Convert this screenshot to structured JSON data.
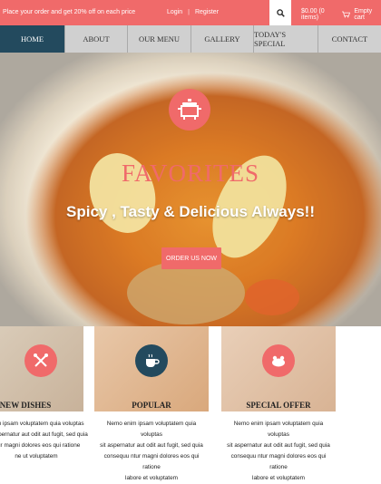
{
  "topbar": {
    "promo": "Place your order and get 20% off on each price",
    "login": "Login",
    "register": "Register",
    "cart_total": "$0.00 (0 items)",
    "cart_label": "Empty cart"
  },
  "nav": {
    "items": [
      {
        "label": "HOME"
      },
      {
        "label": "ABOUT"
      },
      {
        "label": "OUR MENU"
      },
      {
        "label": "GALLERY"
      },
      {
        "label": "TODAY'S SPECIAL"
      },
      {
        "label": "CONTACT"
      }
    ]
  },
  "hero": {
    "title": "FAVORITES",
    "tagline": "Spicy , Tasty & Delicious Always!!",
    "cta": "ORDER US NOW"
  },
  "features": [
    {
      "title": "NEW DISHES",
      "icon": "fork-knife-icon",
      "text": [
        "enim ipsam voluptatem quia voluptas",
        "sit aspernatur aut odit aut fugit, sed quia",
        "ntur magni dolores eos qui ratione",
        "ne ut voluptatem"
      ]
    },
    {
      "title": "POPULAR",
      "icon": "coffee-cup-icon",
      "text": [
        "Nemo enim ipsam voluptatem quia voluptas",
        "sit aspernatur aut odit aut fugit, sed quia",
        "consequu ntur magni dolores eos qui ratione",
        "labore et voluptatem"
      ]
    },
    {
      "title": "SPECIAL OFFER",
      "icon": "roast-chicken-icon",
      "text": [
        "Nemo enim ipsam voluptatem quia voluptas",
        "sit aspernatur aut odit aut fugit, sed quia",
        "consequu ntur magni dolores eos qui ratione",
        "labore et voluptatem"
      ]
    }
  ],
  "colors": {
    "accent": "#f06a6a",
    "nav_active": "#234a5e",
    "nav_bg": "#c9c9c9"
  }
}
